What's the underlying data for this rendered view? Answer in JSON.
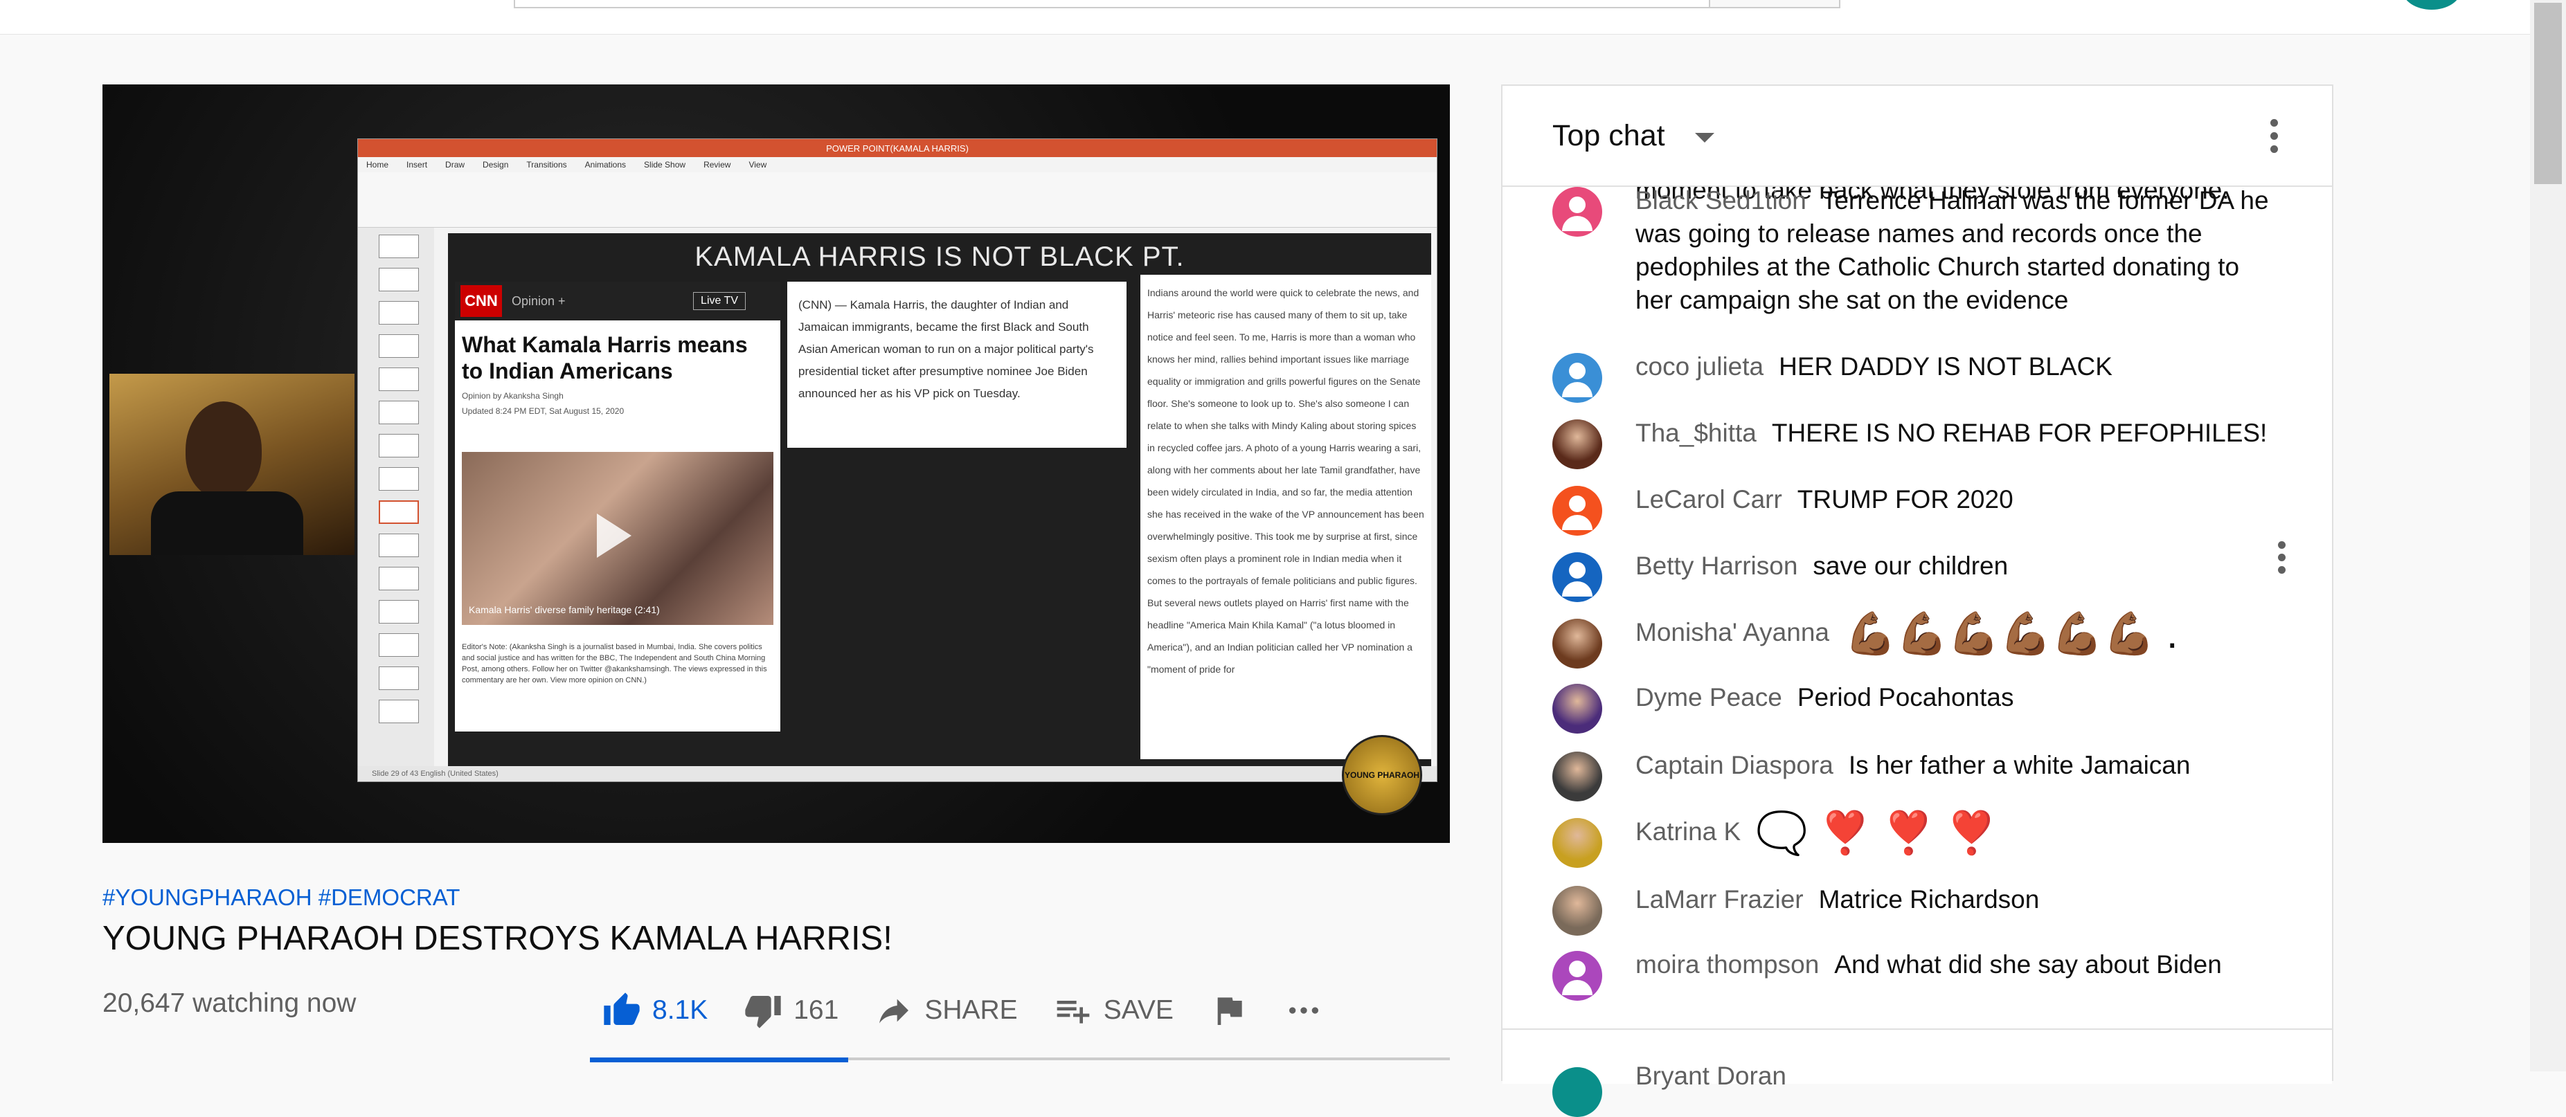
{
  "header": {
    "search_placeholder": ""
  },
  "player": {
    "slide_window_title": "POWER POINT(KAMALA HARRIS)",
    "ribbon_tabs": [
      "Home",
      "Insert",
      "Draw",
      "Design",
      "Transitions",
      "Animations",
      "Slide Show",
      "Review",
      "View"
    ],
    "slide_title": "KAMALA HARRIS IS NOT BLACK PT.",
    "cnn_logo": "CNN",
    "cnn_opinion": "Opinion +",
    "cnn_live": "Live TV",
    "cnn_headline": "What Kamala Harris means to Indian Americans",
    "cnn_byline": "Opinion by Akanksha Singh",
    "cnn_updated": "Updated 8:24 PM EDT, Sat August 15, 2020",
    "cnn_caption": "Kamala Harris' diverse family heritage (2:41)",
    "cnn_note": "Editor's Note: (Akanksha Singh is a journalist based in Mumbai, India. She covers politics and social justice and has written for the BBC, The Independent and South China Morning Post, among others. Follow her on Twitter @akankshamsingh. The views expressed in this commentary are her own. View more opinion on CNN.)",
    "mid_text": "(CNN) — Kamala Harris, the daughter of Indian and Jamaican immigrants, became the first Black and South Asian American woman to run on a major political party's presidential ticket after presumptive nominee Joe Biden announced her as his VP pick on Tuesday.",
    "right_text": "Indians around the world were quick to celebrate the news, and Harris' meteoric rise has caused many of them to sit up, take notice and feel seen. To me, Harris is more than a woman who knows her mind, rallies behind important issues like marriage equality or immigration and grills powerful figures on the Senate floor. She's someone to look up to. She's also someone I can relate to when she talks with Mindy Kaling about storing spices in recycled coffee jars. A photo of a young Harris wearing a sari, along with her comments about her late Tamil grandfather, have been widely circulated in India, and so far, the media attention she has received in the wake of the VP announcement has been overwhelmingly positive. This took me by surprise at first, since sexism often plays a prominent role in Indian media when it comes to the portrayals of female politicians and public figures. But several news outlets played on Harris' first name with the headline \"America Main Khila Kamal\" (\"a lotus bloomed in America\"), and an Indian politician called her VP nomination a \"moment of pride for",
    "status_text": "Slide 29 of 43   English (United States)",
    "badge_text": "YOUNG PHARAOH"
  },
  "video": {
    "tags": "#YOUNGPHARAOH #DEMOCRAT",
    "title": "YOUNG PHARAOH DESTROYS KAMALA HARRIS!",
    "viewers": "20,647 watching now",
    "likes": "8.1K",
    "dislikes": "161",
    "share_label": "SHARE",
    "save_label": "SAVE",
    "like_fraction": 0.3
  },
  "chat": {
    "title": "Top chat",
    "cut_top_text": "moment to take back what they stole from everyone.",
    "messages": [
      {
        "author": "Black Sed1tion",
        "text": "Terrence Halinan was the former DA he was going to release names and records once the pedophiles at the Catholic Church started donating to her campaign she sat on the evidence",
        "color": "#e84a7a",
        "avatar": "default"
      },
      {
        "author": "coco julieta",
        "text": "HER DADDY IS NOT BLACK",
        "color": "#3a8fd6",
        "avatar": "default"
      },
      {
        "author": "Tha_$hitta",
        "text": "THERE IS NO REHAB FOR PEFOPHILES!",
        "color": "#5a2a1a",
        "avatar": "photo"
      },
      {
        "author": "LeCarol Carr",
        "text": "TRUMP FOR 2020",
        "color": "#f4511e",
        "avatar": "default"
      },
      {
        "author": "Betty Harrison",
        "text": "save our children",
        "color": "#1565c0",
        "avatar": "default"
      },
      {
        "author": "Monisha' Ayanna",
        "text": "💪🏾💪🏾💪🏾💪🏾💪🏾💪🏾 .",
        "color": "#6d3b1f",
        "avatar": "photo"
      },
      {
        "author": "Dyme Peace",
        "text": "Period Pocahontas",
        "color": "#4b2c7a",
        "avatar": "photo"
      },
      {
        "author": "Captain Diaspora",
        "text": "Is her father a white Jamaican",
        "color": "#3b3b3b",
        "avatar": "photo"
      },
      {
        "author": "Katrina K",
        "text": "🗨️ ❣️ ❣️ ❣️",
        "color": "#c8a020",
        "avatar": "photo"
      },
      {
        "author": "LaMarr Frazier",
        "text": "Matrice Richardson",
        "color": "#7a6a5a",
        "avatar": "photo"
      },
      {
        "author": "moira thompson",
        "text": "And what did she say about Biden",
        "color": "#ab47bc",
        "avatar": "default"
      }
    ],
    "footer_author": "Bryant Doran"
  }
}
